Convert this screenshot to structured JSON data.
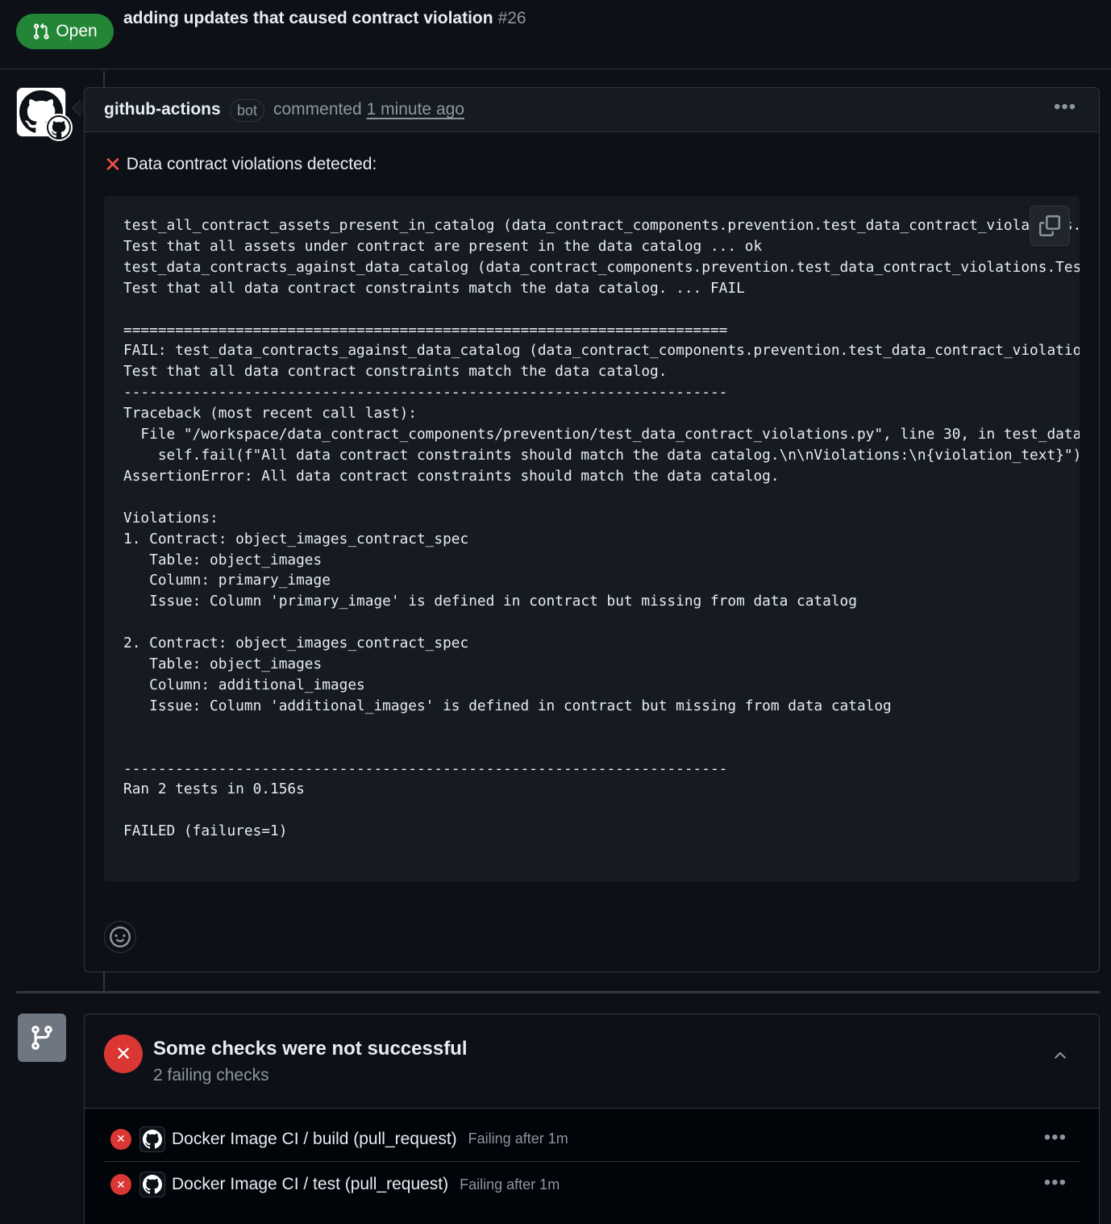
{
  "pr": {
    "state": "Open",
    "title": "adding updates that caused contract violation",
    "number": "#26"
  },
  "comment": {
    "author": "github-actions",
    "author_badge": "bot",
    "action": "commented",
    "timestamp": "1 minute ago",
    "message": "Data contract violations detected:",
    "code": "test_all_contract_assets_present_in_catalog (data_contract_components.prevention.test_data_contract_violations.\nTest that all assets under contract are present in the data catalog ... ok\ntest_data_contracts_against_data_catalog (data_contract_components.prevention.test_data_contract_violations.Tes\nTest that all data contract constraints match the data catalog. ... FAIL\n\n======================================================================\nFAIL: test_data_contracts_against_data_catalog (data_contract_components.prevention.test_data_contract_violatio\nTest that all data contract constraints match the data catalog.\n----------------------------------------------------------------------\nTraceback (most recent call last):\n  File \"/workspace/data_contract_components/prevention/test_data_contract_violations.py\", line 30, in test_data\n    self.fail(f\"All data contract constraints should match the data catalog.\\n\\nViolations:\\n{violation_text}\")\nAssertionError: All data contract constraints should match the data catalog.\n\nViolations:\n1. Contract: object_images_contract_spec\n   Table: object_images\n   Column: primary_image\n   Issue: Column 'primary_image' is defined in contract but missing from data catalog\n\n2. Contract: object_images_contract_spec\n   Table: object_images\n   Column: additional_images\n   Issue: Column 'additional_images' is defined in contract but missing from data catalog\n\n\n----------------------------------------------------------------------\nRan 2 tests in 0.156s\n\nFAILED (failures=1)"
  },
  "checks": {
    "title": "Some checks were not successful",
    "subtitle": "2 failing checks",
    "items": [
      {
        "name": "Docker Image CI / build (pull_request)",
        "status": "Failing after 1m"
      },
      {
        "name": "Docker Image CI / test (pull_request)",
        "status": "Failing after 1m"
      }
    ]
  },
  "icons": {
    "state": "git-pull-request-icon",
    "avatar": "github-mark-icon",
    "copy": "copy-icon",
    "reaction": "smiley-icon",
    "branch": "git-branch-icon",
    "collapse": "chevron-up-icon"
  },
  "colors": {
    "background": "#0d1117",
    "open_green": "#238636",
    "fail_red": "#da3633",
    "muted_text": "#8d96a0",
    "border": "#30363d"
  }
}
